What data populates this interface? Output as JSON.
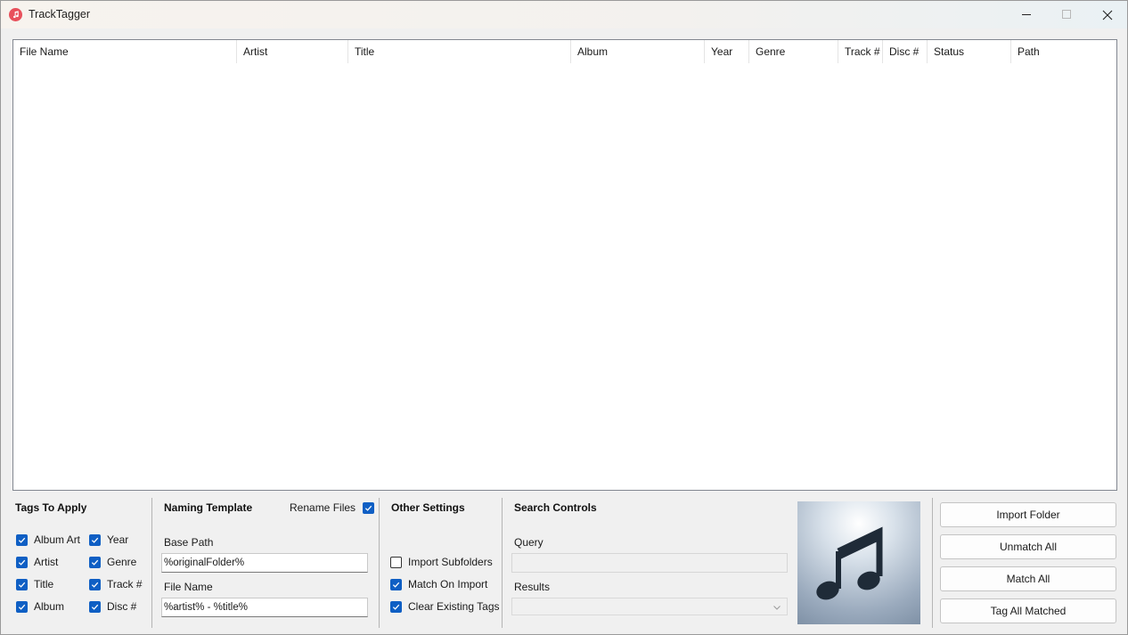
{
  "window": {
    "title": "TrackTagger"
  },
  "grid": {
    "columns": [
      "File Name",
      "Artist",
      "Title",
      "Album",
      "Year",
      "Genre",
      "Track #",
      "Disc #",
      "Status",
      "Path"
    ],
    "rows": []
  },
  "tags_to_apply": {
    "title": "Tags To Apply",
    "items": [
      {
        "label": "Album Art",
        "checked": true
      },
      {
        "label": "Artist",
        "checked": true
      },
      {
        "label": "Title",
        "checked": true
      },
      {
        "label": "Album",
        "checked": true
      },
      {
        "label": "Year",
        "checked": true
      },
      {
        "label": "Genre",
        "checked": true
      },
      {
        "label": "Track #",
        "checked": true
      },
      {
        "label": "Disc #",
        "checked": true
      }
    ]
  },
  "naming_template": {
    "title": "Naming Template",
    "rename_files_label": "Rename Files",
    "rename_files_checked": true,
    "base_path_label": "Base Path",
    "base_path_value": "%originalFolder%",
    "file_name_label": "File Name",
    "file_name_value": "%artist% - %title%"
  },
  "other_settings": {
    "title": "Other Settings",
    "items": [
      {
        "label": "Import Subfolders",
        "checked": false
      },
      {
        "label": "Match On Import",
        "checked": true
      },
      {
        "label": "Clear Existing Tags",
        "checked": true
      }
    ]
  },
  "search_controls": {
    "title": "Search Controls",
    "query_label": "Query",
    "query_value": "",
    "results_label": "Results",
    "results_value": ""
  },
  "album_art": {
    "icon": "music-note-icon"
  },
  "actions": {
    "import_folder": "Import Folder",
    "unmatch_all": "Unmatch All",
    "match_all": "Match All",
    "tag_all_matched": "Tag All Matched"
  },
  "colors": {
    "accent": "#0f5fc4",
    "app_icon": "#e8505b"
  }
}
